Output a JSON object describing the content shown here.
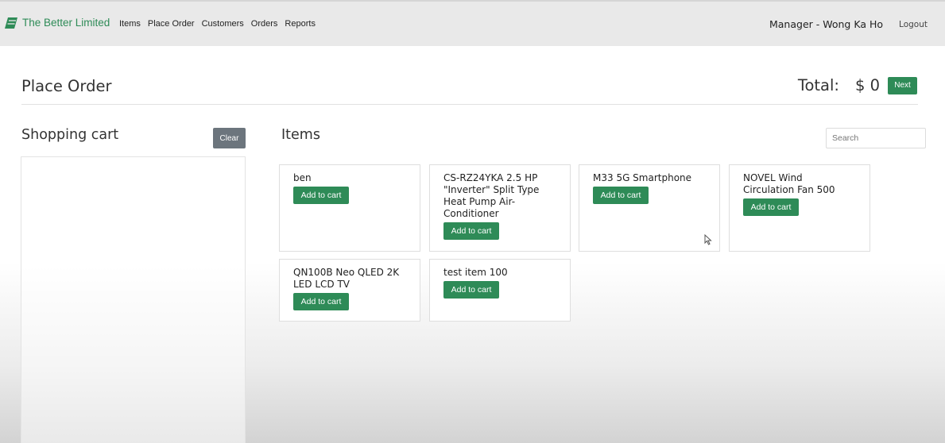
{
  "navbar": {
    "brand": "The Better Limited",
    "links": [
      "Items",
      "Place Order",
      "Customers",
      "Orders",
      "Reports"
    ],
    "user": "Manager - Wong Ka Ho",
    "logout": "Logout",
    "brand_color": "#2e8b57"
  },
  "page": {
    "title": "Place Order",
    "total_label": "Total:",
    "total_value": "$ 0",
    "next_label": "Next"
  },
  "cart": {
    "title": "Shopping cart",
    "clear_label": "Clear"
  },
  "items": {
    "title": "Items",
    "search_placeholder": "Search",
    "add_label": "Add to cart",
    "list": [
      {
        "name": "ben"
      },
      {
        "name": "CS-RZ24YKA 2.5 HP \"Inverter\" Split Type Heat Pump Air-Conditioner"
      },
      {
        "name": "M33 5G Smartphone"
      },
      {
        "name": "NOVEL Wind Circulation Fan 500"
      },
      {
        "name": "QN100B Neo QLED 2K LED LCD TV"
      },
      {
        "name": "test item 100"
      }
    ]
  },
  "colors": {
    "accent": "#2e8b57",
    "secondary_button": "#6c757d",
    "navbar_bg": "#e9e9e9"
  }
}
